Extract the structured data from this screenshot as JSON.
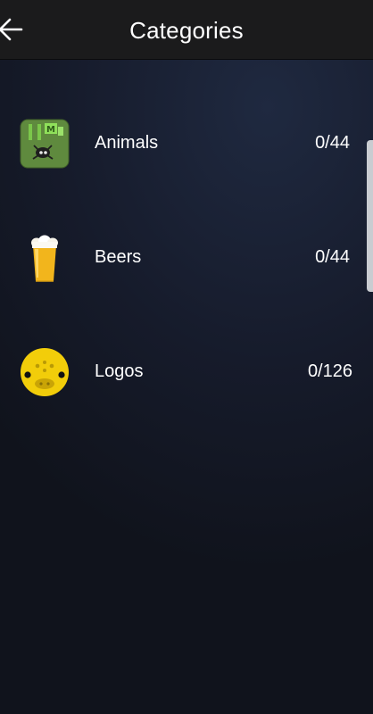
{
  "header": {
    "title": "Categories",
    "back_icon": "arrow-left-icon"
  },
  "categories": [
    {
      "label": "Animals",
      "progress": "0/44",
      "icon": "animals-category-icon"
    },
    {
      "label": "Beers",
      "progress": "0/44",
      "icon": "beer-glass-icon"
    },
    {
      "label": "Logos",
      "progress": "0/126",
      "icon": "yellow-face-icon"
    }
  ],
  "colors": {
    "header_bg": "#1b1b1c",
    "text": "#ffffff",
    "scrollbar": "#c9ccd1"
  }
}
